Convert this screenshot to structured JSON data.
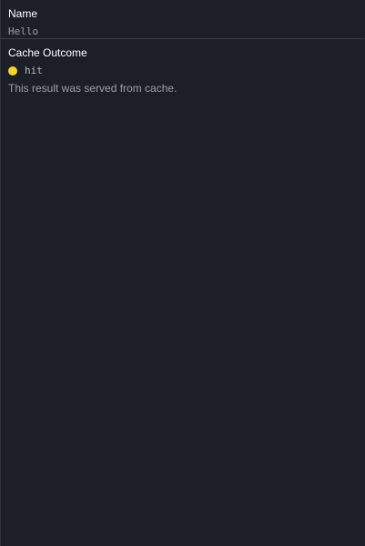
{
  "name_field": {
    "label": "Name",
    "value": "Hello"
  },
  "cache": {
    "label": "Cache Outcome",
    "status": "hit",
    "status_color": "#f6d32d",
    "description": "This result was served from cache."
  }
}
